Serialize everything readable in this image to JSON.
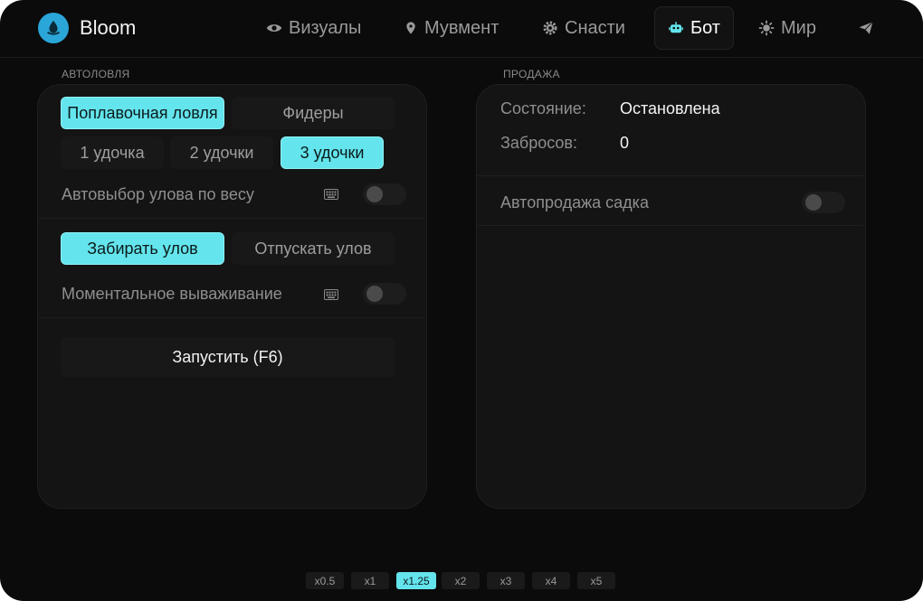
{
  "brand": {
    "name": "Bloom"
  },
  "nav": [
    {
      "label": "Визуалы",
      "icon": "eye-icon"
    },
    {
      "label": "Мувмент",
      "icon": "location-pin-icon"
    },
    {
      "label": "Снасти",
      "icon": "gear-icon"
    },
    {
      "label": "Бот",
      "icon": "robot-icon",
      "active": true
    },
    {
      "label": "Мир",
      "icon": "sun-icon"
    },
    {
      "label": "",
      "icon": "paper-plane-icon"
    }
  ],
  "autofishing": {
    "section_label": "АВТОЛОВЛЯ",
    "mode_options": [
      "Поплавочная ловля",
      "Фидеры"
    ],
    "mode_selected": "Поплавочная ловля",
    "rod_options": [
      "1 удочка",
      "2 удочки",
      "3 удочки"
    ],
    "rod_selected": "3 удочки",
    "auto_select_label": "Автовыбор улова по весу",
    "auto_select_enabled": false,
    "catch_options": [
      "Забирать улов",
      "Отпускать улов"
    ],
    "catch_selected": "Забирать улов",
    "instant_label": "Моментальное вываживание",
    "instant_enabled": false,
    "start_label": "Запустить (F6)"
  },
  "sale": {
    "section_label": "ПРОДАЖА",
    "state_label": "Состояние:",
    "state_value": "Остановлена",
    "casts_label": "Забросов:",
    "casts_value": "0",
    "autosale_label": "Автопродажа садка",
    "autosale_enabled": false
  },
  "zoom": {
    "options": [
      "x0.5",
      "x1",
      "x1.25",
      "x2",
      "x3",
      "x4",
      "x5"
    ],
    "selected": "x1.25"
  },
  "colors": {
    "accent": "#64e4ec",
    "background": "#0b0b0b",
    "panel": "#141414"
  }
}
